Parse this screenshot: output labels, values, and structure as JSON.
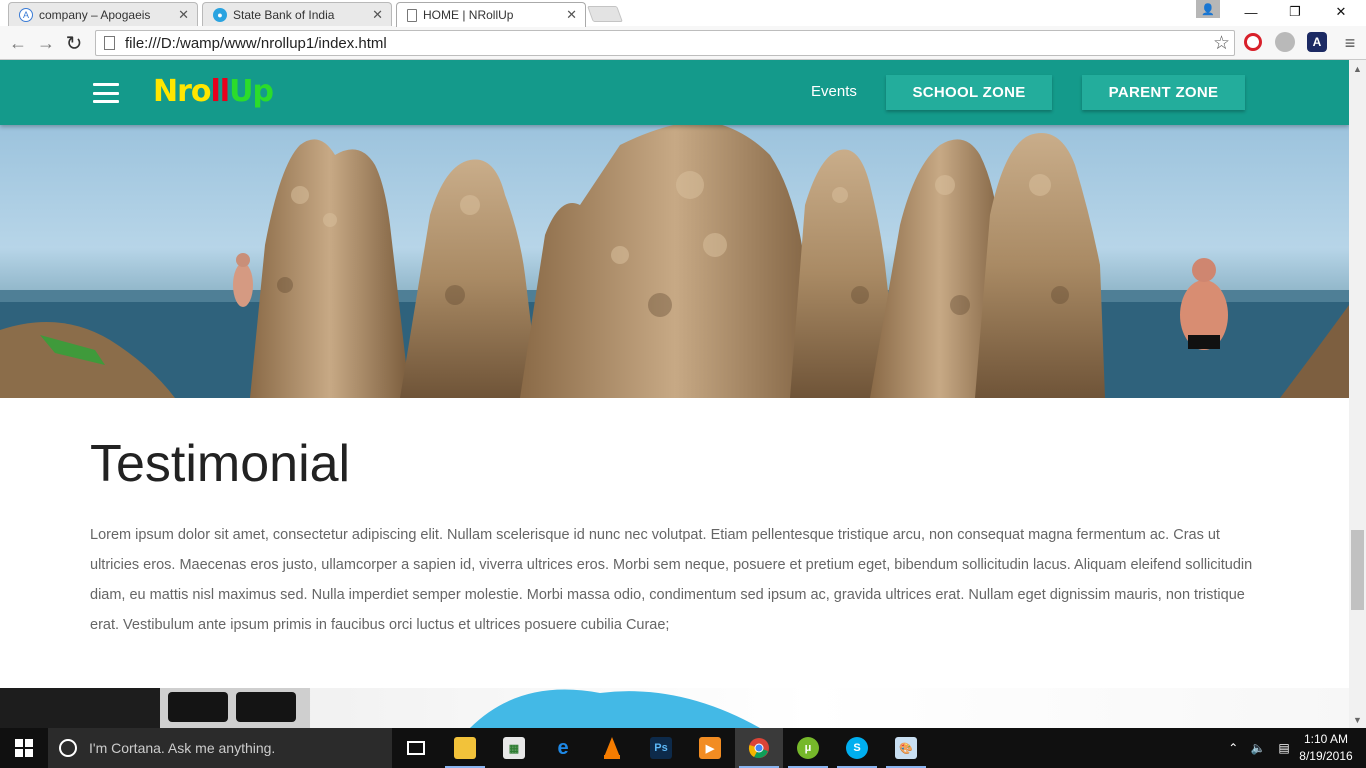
{
  "browser": {
    "tabs": [
      {
        "title": "company – Apogaeis",
        "icon": "apogaeis-icon"
      },
      {
        "title": "State Bank of India",
        "icon": "sbi-icon"
      },
      {
        "title": "HOME | NRollUp",
        "icon": "page-icon",
        "active": true
      }
    ],
    "close_glyph": "✕",
    "url": "file:///D:/wamp/www/nrollup1/index.html",
    "back_glyph": "←",
    "forward_glyph": "→",
    "reload_glyph": "↻",
    "star_glyph": "☆",
    "menu_glyph": "≡",
    "minimize_glyph": "—",
    "restore_glyph": "❐",
    "window_close_glyph": "✕",
    "extensions": [
      "opera-icon",
      "globe-icon",
      "adobe-icon"
    ]
  },
  "site": {
    "logo": {
      "part1": "N",
      "part2": "ro",
      "part3": "ll",
      "part4": "Up"
    },
    "nav": {
      "events": "Events",
      "school_zone": "SCHOOL ZONE",
      "parent_zone": "PARENT ZONE"
    },
    "colors": {
      "header": "#149a8b",
      "button": "#23ad9c"
    },
    "testimonial": {
      "heading": "Testimonial",
      "body": "Lorem ipsum dolor sit amet, consectetur adipiscing elit. Nullam scelerisque id nunc nec volutpat. Etiam pellentesque tristique arcu, non consequat magna fermentum ac. Cras ut ultricies eros. Maecenas eros justo, ullamcorper a sapien id, viverra ultrices eros. Morbi sem neque, posuere et pretium eget, bibendum sollicitudin lacus. Aliquam eleifend sollicitudin diam, eu mattis nisl maximus sed. Nulla imperdiet semper molestie. Morbi massa odio, condimentum sed ipsum ac, gravida ultrices erat. Nullam eget dignissim mauris, non tristique erat. Vestibulum ante ipsum primis in faucibus orci luctus et ultrices posuere cubilia Curae;"
    }
  },
  "taskbar": {
    "cortana_placeholder": "I'm Cortana. Ask me anything.",
    "apps": [
      "task-view-icon",
      "file-explorer-icon",
      "spreadsheet-icon",
      "edge-icon",
      "vlc-icon",
      "photoshop-icon",
      "media-player-icon",
      "chrome-icon",
      "utorrent-icon",
      "skype-icon",
      "paint-icon"
    ],
    "time": "1:10 AM",
    "date": "8/19/2016"
  }
}
